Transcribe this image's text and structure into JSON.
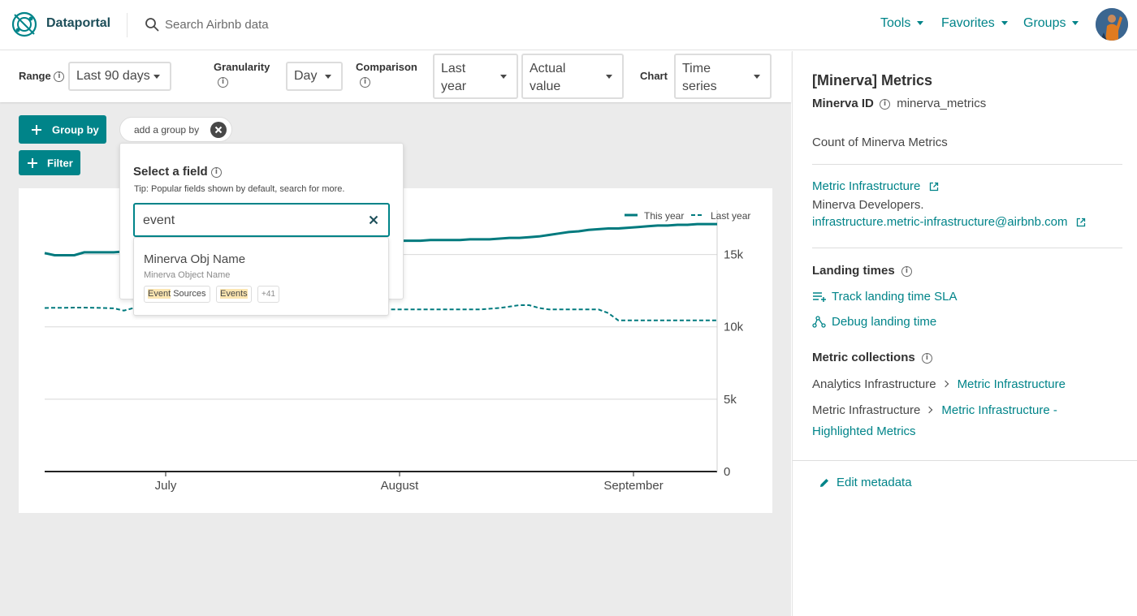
{
  "header": {
    "brand": "Dataportal",
    "search_placeholder": "Search Airbnb data",
    "nav": [
      {
        "label": "Tools"
      },
      {
        "label": "Favorites"
      },
      {
        "label": "Groups"
      }
    ]
  },
  "controls": {
    "range_label": "Range",
    "range_value": "Last 90 days",
    "granularity_label": "Granularity",
    "granularity_value": "Day",
    "comparison_label": "Comparison",
    "comparison_value_line1": "Last",
    "comparison_value_line2": "year",
    "comparison_mode_line1": "Actual",
    "comparison_mode_line2": "value",
    "chart_label": "Chart",
    "chart_value_line1": "Time",
    "chart_value_line2": "series"
  },
  "actions": {
    "group_by_label": "Group by",
    "filter_label": "Filter",
    "chip_label": "add a group by"
  },
  "field_picker": {
    "title": "Select a field",
    "tip": "Tip: Popular fields shown by default, search for more.",
    "search_value": "event",
    "result": {
      "name": "Minerva Obj Name",
      "subtitle": "Minerva Object Name",
      "tags": [
        {
          "highlight": "Event",
          "rest": " Sources"
        },
        {
          "highlight": "Events",
          "rest": ""
        }
      ],
      "more": "+41"
    }
  },
  "chart_data": {
    "type": "line",
    "legend": [
      "This year",
      "Last year"
    ],
    "legend_position": "top-right",
    "x_ticks": [
      "July",
      "August",
      "September"
    ],
    "y_ticks": [
      0,
      5000,
      10000,
      15000
    ],
    "y_tick_labels": [
      "0",
      "5k",
      "10k",
      "15k"
    ],
    "ylim": [
      0,
      17500
    ],
    "grid": true,
    "series": [
      {
        "name": "This year",
        "style": "solid",
        "values": [
          15100,
          14950,
          14950,
          14950,
          15150,
          15150,
          15150,
          15150,
          15200,
          15250,
          15300,
          15300,
          15300,
          15300,
          15350,
          15350,
          15350,
          15400,
          15400,
          15400,
          15450,
          15500,
          15550,
          15600,
          15650,
          15700,
          15750,
          15800,
          15850,
          15900,
          15950,
          15950,
          15950,
          15950,
          15950,
          15950,
          15950,
          15950,
          15950,
          16000,
          16000,
          16000,
          16000,
          16050,
          16050,
          16050,
          16100,
          16150,
          16150,
          16200,
          16250,
          16350,
          16450,
          16550,
          16600,
          16700,
          16750,
          16800,
          16800,
          16850,
          16900,
          16950,
          17000,
          17000,
          17050,
          17050,
          17100,
          17100,
          17100
        ]
      },
      {
        "name": "Last year",
        "style": "dashed",
        "values": [
          11300,
          11320,
          11320,
          11330,
          11330,
          11320,
          11300,
          11280,
          11120,
          11300,
          11330,
          11350,
          11380,
          11420,
          11450,
          11450,
          11450,
          11450,
          11450,
          11450,
          11420,
          11420,
          11420,
          11400,
          11400,
          11400,
          11450,
          11470,
          11550,
          11450,
          11780,
          11700,
          11200,
          11200,
          11200,
          11200,
          11200,
          11200,
          11200,
          11200,
          11200,
          11200,
          11200,
          11200,
          11200,
          11250,
          11300,
          11400,
          11500,
          11500,
          11300,
          11200,
          11200,
          11200,
          11200,
          11200,
          11200,
          10950,
          10450,
          10450,
          10450,
          10450,
          10450,
          10450,
          10450,
          10450,
          10450,
          10450,
          10450
        ]
      }
    ]
  },
  "panel": {
    "title": "[Minerva] Metrics",
    "minerva_id_label": "Minerva ID",
    "minerva_id_value": "minerva_metrics",
    "description": "Count of Minerva Metrics",
    "owner_team": "Metric Infrastructure",
    "owner_group": "Minerva Developers.",
    "owner_email": "infrastructure.metric-infrastructure@airbnb.com",
    "landing_title": "Landing times",
    "landing_link1": "Track landing time SLA",
    "landing_link2": "Debug landing time",
    "collections_title": "Metric collections",
    "collections": [
      {
        "parent": "Analytics Infrastructure",
        "child": "Metric Infrastructure"
      },
      {
        "parent": "Metric Infrastructure",
        "child_line1": "Metric Infrastructure -",
        "child_line2": "Highlighted Metrics"
      }
    ],
    "edit_label": "Edit metadata"
  },
  "colors": {
    "accent": "#008489",
    "brand_text": "#1d4e59",
    "highlight": "#fce6b1"
  }
}
